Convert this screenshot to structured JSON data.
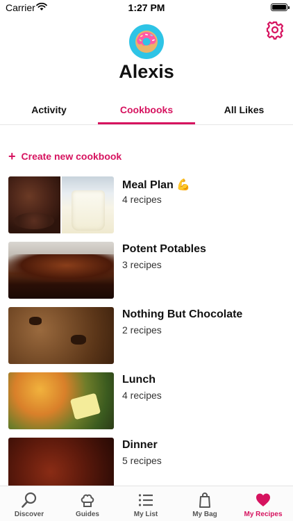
{
  "status_bar": {
    "carrier": "Carrier",
    "time": "1:27 PM",
    "icons": [
      "wifi-icon",
      "battery-icon"
    ]
  },
  "profile": {
    "name": "Alexis",
    "avatar_icon": "donut-icon",
    "settings_icon": "gear-icon"
  },
  "tabs": [
    {
      "label": "Activity",
      "active": false
    },
    {
      "label": "Cookbooks",
      "active": true
    },
    {
      "label": "All Likes",
      "active": false
    }
  ],
  "create_cookbook": {
    "icon": "plus-icon",
    "label": "Create new cookbook"
  },
  "cookbooks": [
    {
      "title": "Meal Plan",
      "emoji": "💪",
      "count": "4 recipes"
    },
    {
      "title": "Potent Potables",
      "count": "3 recipes"
    },
    {
      "title": "Nothing But Chocolate",
      "count": "2 recipes"
    },
    {
      "title": "Lunch",
      "count": "4 recipes"
    },
    {
      "title": "Dinner",
      "count": "5 recipes"
    }
  ],
  "tab_bar": [
    {
      "label": "Discover",
      "icon": "search-icon",
      "active": false
    },
    {
      "label": "Guides",
      "icon": "chef-hat-icon",
      "active": false
    },
    {
      "label": "My List",
      "icon": "list-icon",
      "active": false
    },
    {
      "label": "My Bag",
      "icon": "shopping-bag-icon",
      "active": false
    },
    {
      "label": "My Recipes",
      "icon": "heart-icon",
      "active": true
    }
  ],
  "colors": {
    "accent": "#d6135f",
    "avatar_bg": "#2ec4e6",
    "text": "#111111",
    "tab_bar_bg": "#fbfbfb"
  }
}
